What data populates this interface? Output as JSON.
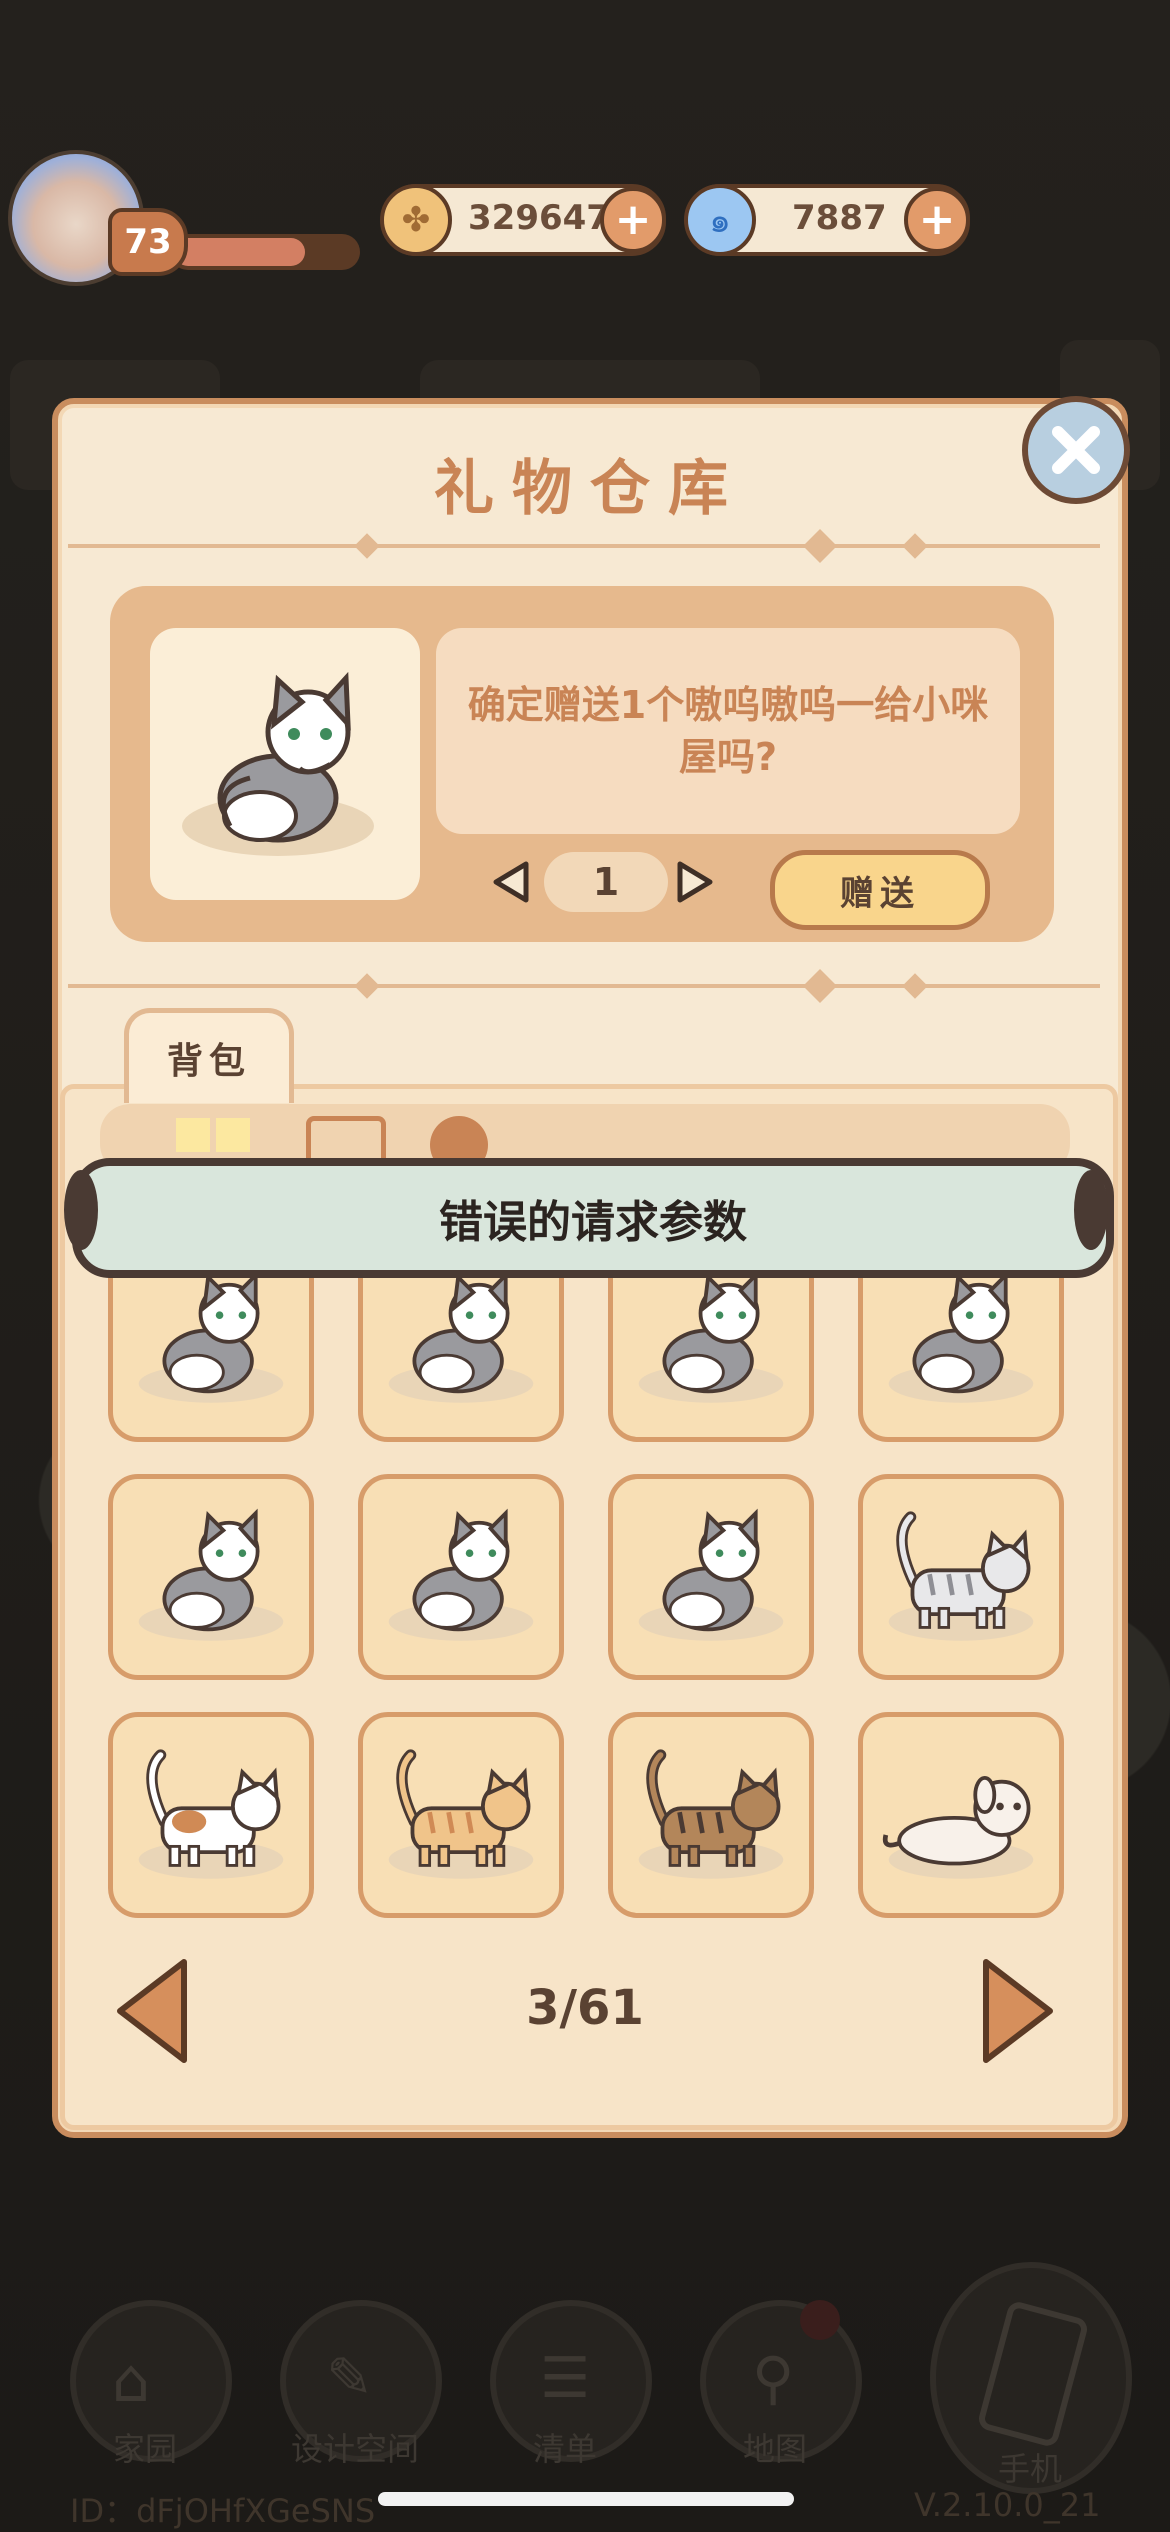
{
  "hud": {
    "level": "73",
    "exp_fraction": 0.72,
    "coins": "329647",
    "gems": "7887",
    "coin_icon": "clover-coin-icon",
    "gem_icon": "swirl-gem-icon"
  },
  "panel": {
    "title": "礼物仓库",
    "confirm_message": "确定赠送1个嗷呜嗷呜一给小咪屋吗?",
    "quantity": "1",
    "send_label": "赠送",
    "tab_label": "背包"
  },
  "toast": {
    "message": "错误的请求参数"
  },
  "inventory": {
    "items": [
      {
        "kind": "grey-tabby-sitting"
      },
      {
        "kind": "grey-tabby-sitting"
      },
      {
        "kind": "grey-tabby-sitting"
      },
      {
        "kind": "grey-tabby-sitting"
      },
      {
        "kind": "grey-tabby-sitting"
      },
      {
        "kind": "grey-tabby-sitting"
      },
      {
        "kind": "grey-tabby-sitting"
      },
      {
        "kind": "silver-tabby-standing"
      },
      {
        "kind": "calico-standing"
      },
      {
        "kind": "orange-tabby-standing"
      },
      {
        "kind": "leopard-standing"
      },
      {
        "kind": "white-dog-lying"
      }
    ],
    "page_indicator": "3/61"
  },
  "nav": {
    "items": [
      {
        "label": "家园",
        "icon": "home-icon"
      },
      {
        "label": "设计空间",
        "icon": "design-icon"
      },
      {
        "label": "清单",
        "icon": "list-icon"
      },
      {
        "label": "地图",
        "icon": "map-pin-icon"
      },
      {
        "label": "手机",
        "icon": "phone-icon"
      }
    ]
  },
  "footer": {
    "user_id": "ID：dFjOHfXGeSNS",
    "version": "V.2.10.0_21"
  }
}
